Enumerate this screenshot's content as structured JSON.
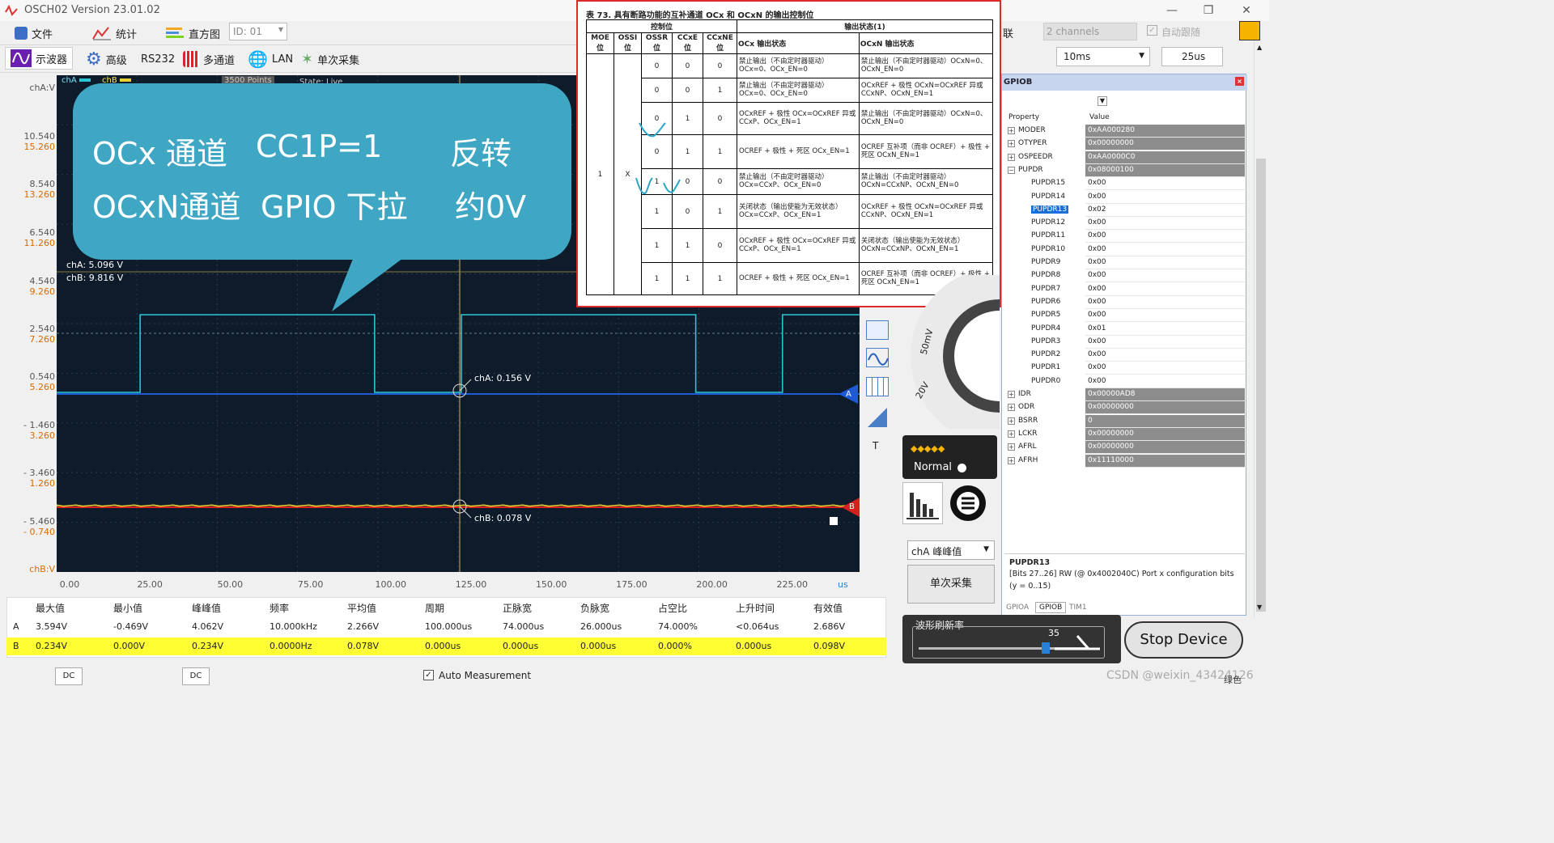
{
  "window": {
    "title": "OSCH02   Version 23.01.02"
  },
  "menu": {
    "file": "文件",
    "stats": "统计",
    "histogram": "直方图",
    "id_value": "ID: 01"
  },
  "toolbar": {
    "scope": "示波器",
    "advanced": "高级",
    "rs232": "RS232",
    "multichannel": "多通道",
    "lan": "LAN",
    "single": "单次采集"
  },
  "scope": {
    "cha_tab": "chA",
    "chb_tab": "chB",
    "points": "3500 Points",
    "state": "State: Live",
    "cha_axis": "chA:V",
    "chb_axis": "chB:V",
    "cha_readout": "chA: 5.096 V",
    "chb_readout": "chB: 9.816 V",
    "cursor_a": "chA: 0.156 V",
    "cursor_b": "chB: 0.078 V",
    "marker_a": "A",
    "marker_b": "B",
    "unit": "us",
    "y_ticks_a": [
      "10.540",
      "8.540",
      "6.540",
      "4.540",
      "2.540",
      "0.540",
      "- 1.460",
      "- 3.460",
      "- 5.460"
    ],
    "y_ticks_b": [
      "15.260",
      "13.260",
      "11.260",
      "9.260",
      "7.260",
      "5.260",
      "3.260",
      "1.260",
      "- 0.740"
    ],
    "x_ticks": [
      "0.00",
      "25.00",
      "50.00",
      "75.00",
      "100.00",
      "125.00",
      "150.00",
      "175.00",
      "200.00",
      "225.00"
    ]
  },
  "bubble": {
    "line1": [
      "OCx 通道",
      "CC1P=1",
      "反转"
    ],
    "line2": [
      "OCxN通道",
      "GPIO 下拉",
      "约0V"
    ]
  },
  "measurements": {
    "headers": [
      "最大值",
      "最小值",
      "峰峰值",
      "频率",
      "平均值",
      "周期",
      "正脉宽",
      "负脉宽",
      "占空比",
      "上升时间",
      "有效值"
    ],
    "a_label": "A",
    "b_label": "B",
    "a": [
      "3.594V",
      "-0.469V",
      "4.062V",
      "10.000kHz",
      "2.266V",
      "100.000us",
      "74.000us",
      "26.000us",
      "74.000%",
      "<0.064us",
      "2.686V"
    ],
    "b": [
      "0.234V",
      "0.000V",
      "0.234V",
      "0.0000Hz",
      "0.078V",
      "0.000us",
      "0.000us",
      "0.000us",
      "0.000%",
      "0.000us",
      "0.098V"
    ]
  },
  "status": {
    "dc1": "DC",
    "dc2": "DC",
    "auto": "Auto Measurement"
  },
  "table": {
    "caption": "表 73.          具有断路功能的互补通道 OCx 和 OCxN 的输出控制位",
    "ctrl": "控制位",
    "outstate": "输出状态(1)",
    "cols": [
      "MOE\n位",
      "OSSI\n位",
      "OSSR\n位",
      "CCxE\n位",
      "CCxNE\n位"
    ],
    "ocx_head": "OCx 输出状态",
    "ocxn_head": "OCxN 输出状态",
    "moe": "1",
    "ossi": "X",
    "rows": [
      {
        "ossr": "0",
        "ccxe": "0",
        "ccxne": "0",
        "ocx": "禁止输出（不由定时器驱动）OCx=0、OCx_EN=0",
        "ocxn": "禁止输出（不由定时器驱动）OCxN=0、OCxN_EN=0"
      },
      {
        "ossr": "0",
        "ccxe": "0",
        "ccxne": "1",
        "ocx": "禁止输出（不由定时器驱动）OCx=0、OCx_EN=0",
        "ocxn": "OCxREF + 极性 OCxN=OCxREF 异或 CCxNP、OCxN_EN=1"
      },
      {
        "ossr": "0",
        "ccxe": "1",
        "ccxne": "0",
        "ocx": "OCxREF + 极性 OCx=OCxREF 异或 CCxP、OCx_EN=1",
        "ocxn": "禁止输出（不由定时器驱动）OCxN=0、OCxN_EN=0"
      },
      {
        "ossr": "0",
        "ccxe": "1",
        "ccxne": "1",
        "ocx": "OCREF + 极性 + 死区 OCx_EN=1",
        "ocxn": "OCREF 互补项（而非 OCREF）+ 极性 + 死区 OCxN_EN=1"
      },
      {
        "ossr": "1",
        "ccxe": "0",
        "ccxne": "0",
        "ocx": "禁止输出（不由定时器驱动）OCx=CCxP、OCx_EN=0",
        "ocxn": "禁止输出（不由定时器驱动）OCxN=CCxNP、OCxN_EN=0"
      },
      {
        "ossr": "1",
        "ccxe": "0",
        "ccxne": "1",
        "ocx": "关闭状态（输出使能为无效状态）OCx=CCxP、OCx_EN=1",
        "ocxn": "OCxREF + 极性 OCxN=OCxREF 异或 CCxNP、OCxN_EN=1"
      },
      {
        "ossr": "1",
        "ccxe": "1",
        "ccxne": "0",
        "ocx": "OCxREF + 极性 OCx=OCxREF 异或 CCxP、OCx_EN=1",
        "ocxn": "关闭状态（输出使能为无效状态）OCxN=CCxNP、OCxN_EN=1"
      },
      {
        "ossr": "1",
        "ccxe": "1",
        "ccxne": "1",
        "ocx": "OCREF + 极性 + 死区 OCx_EN=1",
        "ocxn": "OCREF 互补项（而非 OCREF）+ 极性 + 死区 OCxN_EN=1"
      }
    ]
  },
  "right": {
    "lian": "联",
    "channels": "2 channels",
    "follow": "自动跟随",
    "time1": "10ms",
    "time2": "25us",
    "mv": "50mV",
    "v": "20V",
    "normal": "Normal",
    "peak": "chA 峰峰值",
    "single": "单次采集",
    "refresh_label": "波形刷新率",
    "refresh_value": "35",
    "stop": "Stop Device",
    "corner": "绿色",
    "t_label": "T"
  },
  "gpio": {
    "title": "GPIOB",
    "prop": "Property",
    "value": "Value",
    "rows": [
      {
        "name": "MODER",
        "value": "0xAA000280",
        "kind": "group"
      },
      {
        "name": "OTYPER",
        "value": "0x00000000",
        "kind": "group"
      },
      {
        "name": "OSPEEDR",
        "value": "0xAA0000C0",
        "kind": "group"
      },
      {
        "name": "PUPDR",
        "value": "0x08000100",
        "kind": "open"
      },
      {
        "name": "PUPDR15",
        "value": "0x00",
        "kind": "child"
      },
      {
        "name": "PUPDR14",
        "value": "0x00",
        "kind": "child"
      },
      {
        "name": "PUPDR13",
        "value": "0x02",
        "kind": "sel"
      },
      {
        "name": "PUPDR12",
        "value": "0x00",
        "kind": "child"
      },
      {
        "name": "PUPDR11",
        "value": "0x00",
        "kind": "child"
      },
      {
        "name": "PUPDR10",
        "value": "0x00",
        "kind": "child"
      },
      {
        "name": "PUPDR9",
        "value": "0x00",
        "kind": "child"
      },
      {
        "name": "PUPDR8",
        "value": "0x00",
        "kind": "child"
      },
      {
        "name": "PUPDR7",
        "value": "0x00",
        "kind": "child"
      },
      {
        "name": "PUPDR6",
        "value": "0x00",
        "kind": "child"
      },
      {
        "name": "PUPDR5",
        "value": "0x00",
        "kind": "child"
      },
      {
        "name": "PUPDR4",
        "value": "0x01",
        "kind": "child"
      },
      {
        "name": "PUPDR3",
        "value": "0x00",
        "kind": "child"
      },
      {
        "name": "PUPDR2",
        "value": "0x00",
        "kind": "child"
      },
      {
        "name": "PUPDR1",
        "value": "0x00",
        "kind": "child"
      },
      {
        "name": "PUPDR0",
        "value": "0x00",
        "kind": "child"
      },
      {
        "name": "IDR",
        "value": "0x00000AD8",
        "kind": "group"
      },
      {
        "name": "ODR",
        "value": "0x00000000",
        "kind": "group"
      },
      {
        "name": "BSRR",
        "value": "0",
        "kind": "group"
      },
      {
        "name": "LCKR",
        "value": "0x00000000",
        "kind": "group"
      },
      {
        "name": "AFRL",
        "value": "0x00000000",
        "kind": "group"
      },
      {
        "name": "AFRH",
        "value": "0x11110000",
        "kind": "group"
      }
    ],
    "desc_title": "PUPDR13",
    "desc_text": "[Bits 27..26] RW (@ 0x4002040C) Port x configuration bits (y = 0..15)",
    "tabs": [
      "GPIOA",
      "GPIOB",
      "TIM1"
    ]
  },
  "watermark": "CSDN @weixin_43424126",
  "colors": {
    "cha": "#2ac6d6",
    "chb": "#e8d233",
    "bubble": "#3fa7c3",
    "screen": "#0d1b2a"
  }
}
